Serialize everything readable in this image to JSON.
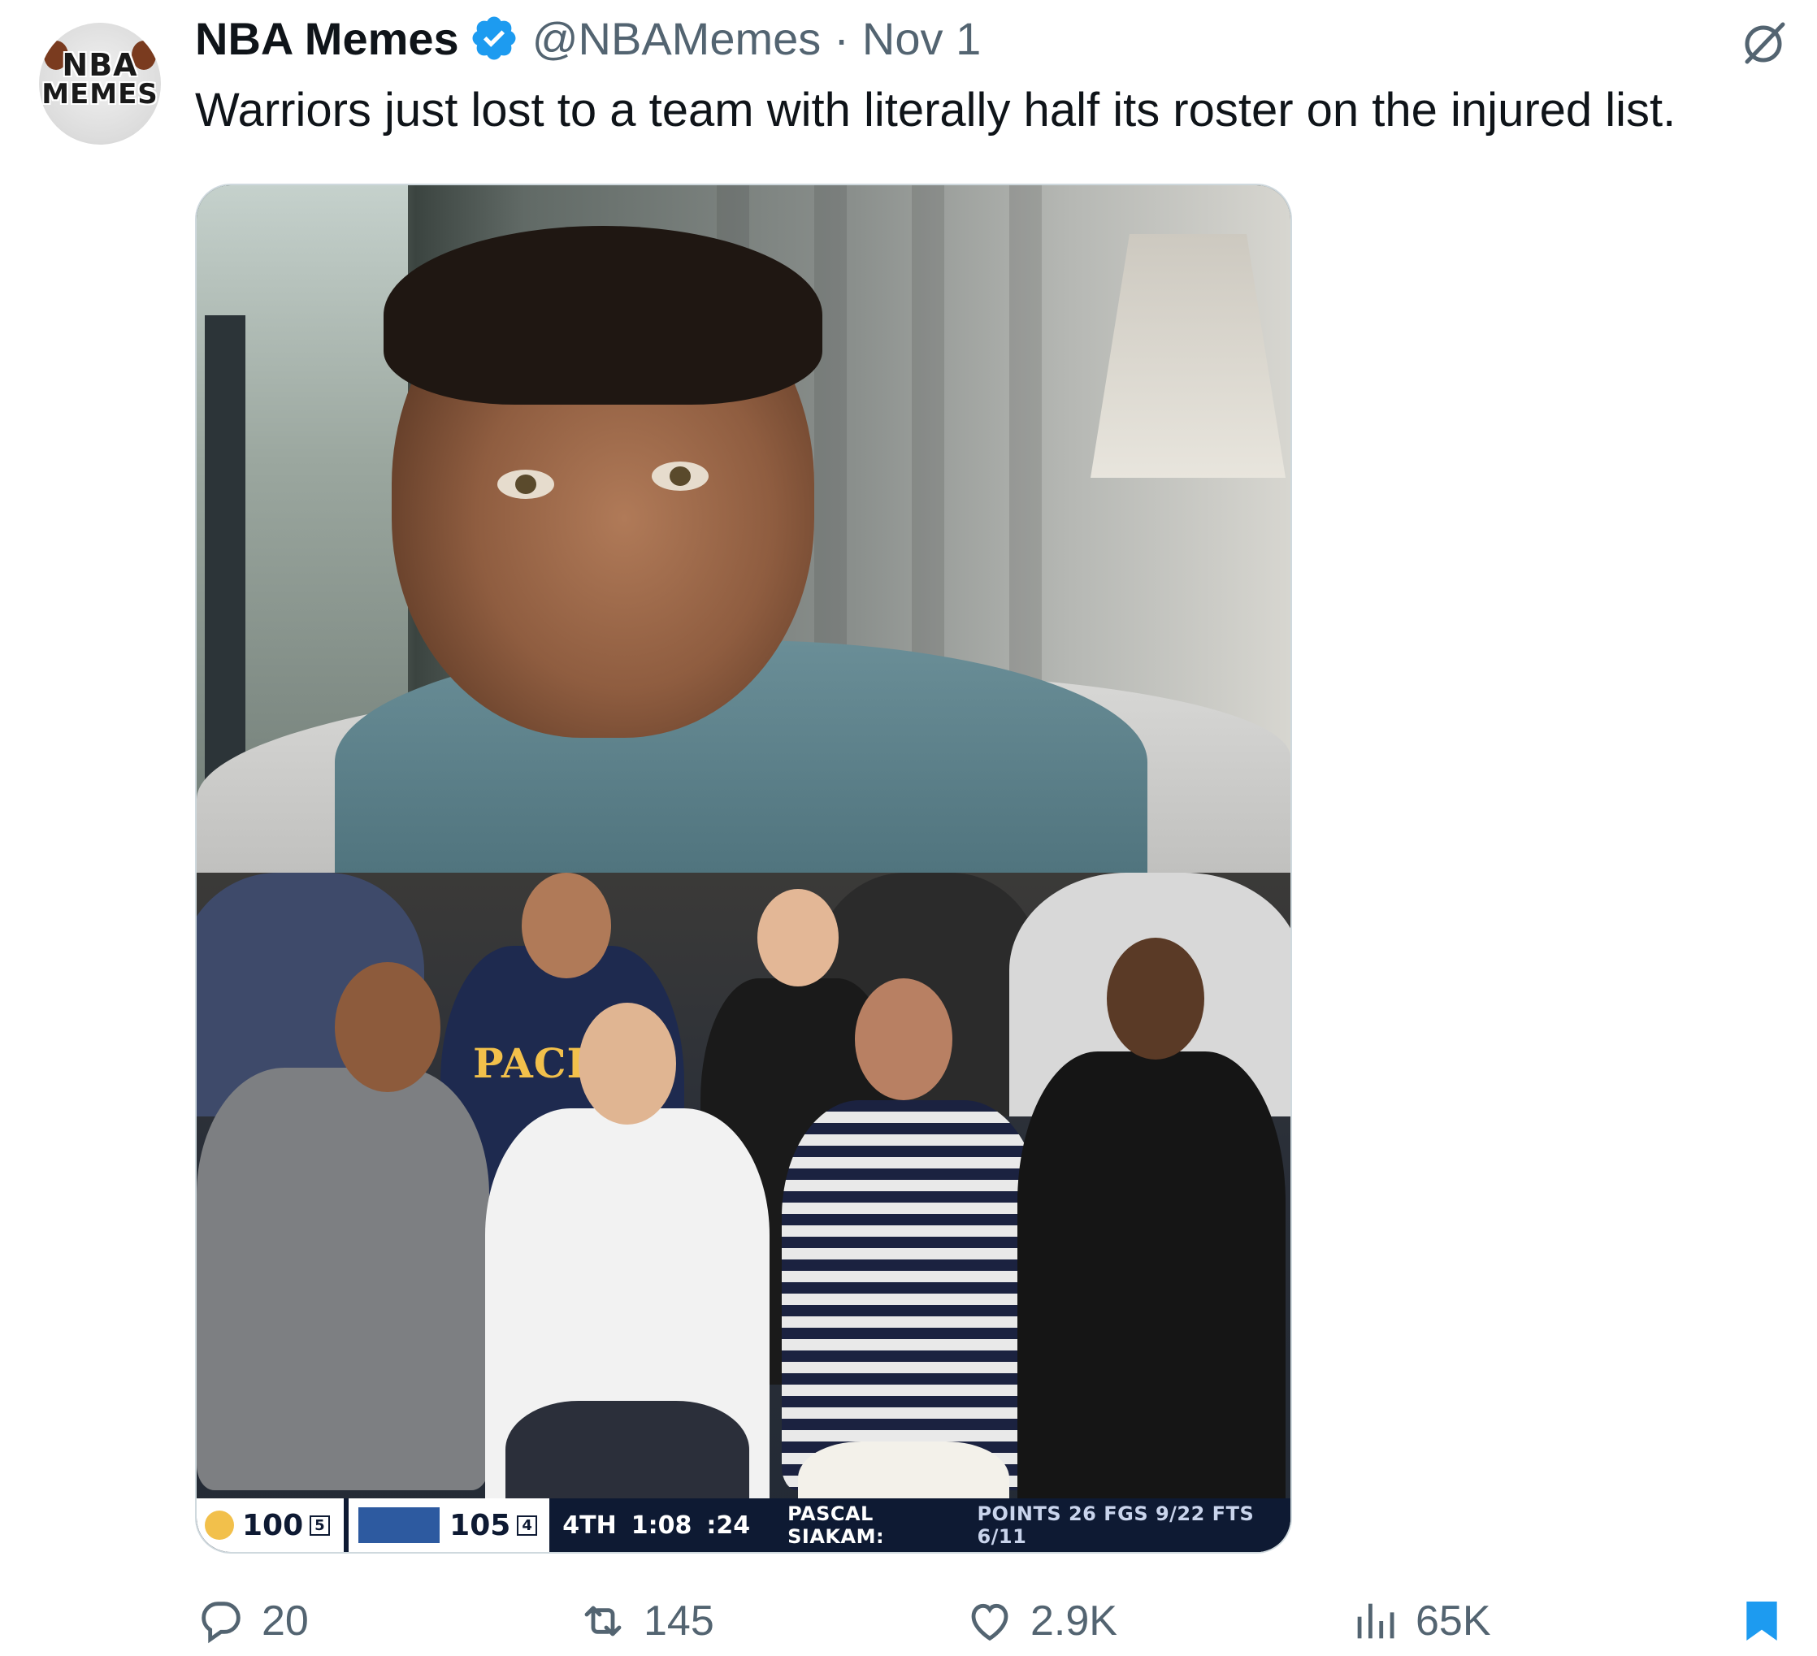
{
  "tweet": {
    "avatar": {
      "line1": "NBA",
      "line2": "MEMES"
    },
    "display_name": "NBA Memes",
    "handle": "@NBAMemes",
    "separator": "·",
    "date": "Nov 1",
    "text": "Warriors just lost to a team with literally half its roster on the injured list.",
    "verified_color": "#1d9bf0",
    "grok_icon": "grok-icon"
  },
  "media": {
    "jersey_text": "PACERS",
    "scorebar": {
      "team1_score": "100",
      "team1_fouls": "5",
      "team2_score": "105",
      "team2_fouls": "4",
      "period": "4TH",
      "clock": "1:08",
      "shot_clock": ":24",
      "player": "PASCAL SIAKAM:",
      "stats": "POINTS 26  FGS 9/22  FTS 6/11"
    }
  },
  "actions": {
    "replies": "20",
    "retweets": "145",
    "likes": "2.9K",
    "views": "65K",
    "bookmark_color": "#1d9bf0"
  }
}
